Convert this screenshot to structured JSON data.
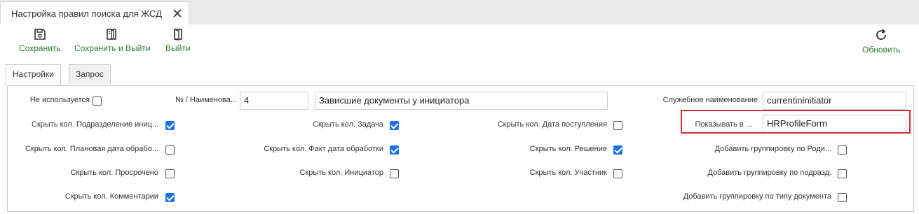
{
  "document_tab": {
    "title": "Настройка правил поиска для ЖСД"
  },
  "toolbar": {
    "save_label": "Сохранить",
    "save_exit_label": "Сохранить и Выйти",
    "exit_label": "Выйти",
    "refresh_label": "Обновить"
  },
  "tabs": [
    "Настройки",
    "Запрос"
  ],
  "form": {
    "not_used": {
      "label": "Не используется",
      "checked": false
    },
    "num_name_label": "№ / Наименова...",
    "number_value": "4",
    "name_value": "Зависшие документы у инициатора",
    "service_name_label": "Служебное наименование",
    "service_name_value": "currentininitiator",
    "show_in_label": "Показывать в ...",
    "show_in_value": "HRProfileForm",
    "checkboxes": [
      {
        "label": "Скрыть кол. Подразделение иниц...",
        "checked": true
      },
      {
        "label": "Скрыть кол. Плановая дата обрабо...",
        "checked": false
      },
      {
        "label": "Скрыть кол. Просрочено",
        "checked": false
      },
      {
        "label": "Скрыть кол. Комментарии",
        "checked": true
      },
      {
        "label": "Скрыть кол. Задача",
        "checked": true
      },
      {
        "label": "Скрыть кол. Факт дата обработки",
        "checked": true
      },
      {
        "label": "Скрыть кол. Инициатор",
        "checked": false
      },
      {
        "label": "Скрыть кол. Дата поступления",
        "checked": false
      },
      {
        "label": "Скрыть кол. Решение",
        "checked": true
      },
      {
        "label": "Скрыть кол. Участник",
        "checked": false
      },
      {
        "label": "Добавить группировку по Роди...",
        "checked": false
      },
      {
        "label": "Добавить группировку по подразд.",
        "checked": false
      },
      {
        "label": "Добавить группировку по типу документа",
        "checked": false
      }
    ]
  },
  "colors": {
    "accent": "#2e7d32",
    "checkbox": "#1a73e8",
    "highlight": "#d32f2f"
  }
}
